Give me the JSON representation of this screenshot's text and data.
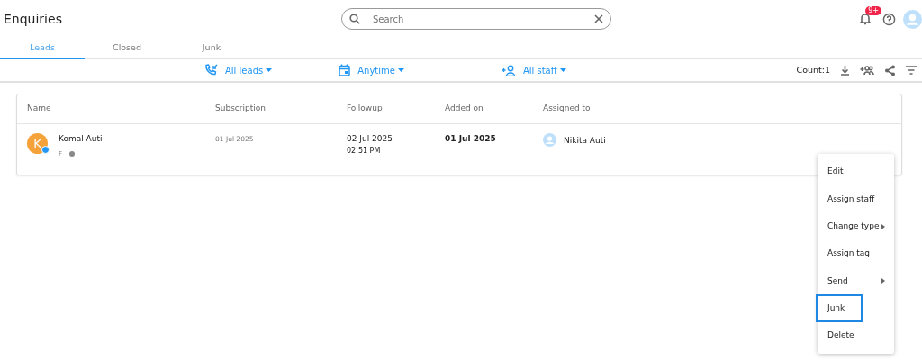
{
  "header": {
    "title": "Enquiries",
    "search": {
      "placeholder": "Search"
    },
    "notification_badge": "9+"
  },
  "tabs": [
    {
      "label": "Leads",
      "selected": true
    },
    {
      "label": "Closed",
      "selected": false
    },
    {
      "label": "Junk",
      "selected": false
    }
  ],
  "filters": [
    {
      "kind": "calls",
      "label": "All leads"
    },
    {
      "kind": "date",
      "label": "Anytime"
    },
    {
      "kind": "staff",
      "label": "All staff"
    }
  ],
  "count": "Count:1",
  "table": {
    "columns": [
      "Name",
      "Subscription",
      "Followup",
      "Added on",
      "Assigned to"
    ],
    "rows": [
      {
        "initial": "K",
        "name": "Komal Auti",
        "gender": "F",
        "subscription": "01 Jul 2025",
        "followup_date": "02 Jul 2025",
        "followup_time": "02:51 PM",
        "added_on": "01 Jul 2025",
        "assigned_to": "Nikita Auti"
      }
    ]
  },
  "context_menu": [
    {
      "label": "Edit",
      "submenu": false,
      "highlighted": false
    },
    {
      "label": "Assign staff",
      "submenu": false,
      "highlighted": false
    },
    {
      "label": "Change type",
      "submenu": true,
      "highlighted": false
    },
    {
      "label": "Assign tag",
      "submenu": false,
      "highlighted": false
    },
    {
      "label": "Send",
      "submenu": true,
      "highlighted": false
    },
    {
      "label": "Junk",
      "submenu": false,
      "highlighted": true
    },
    {
      "label": "Delete",
      "submenu": false,
      "highlighted": false
    }
  ]
}
